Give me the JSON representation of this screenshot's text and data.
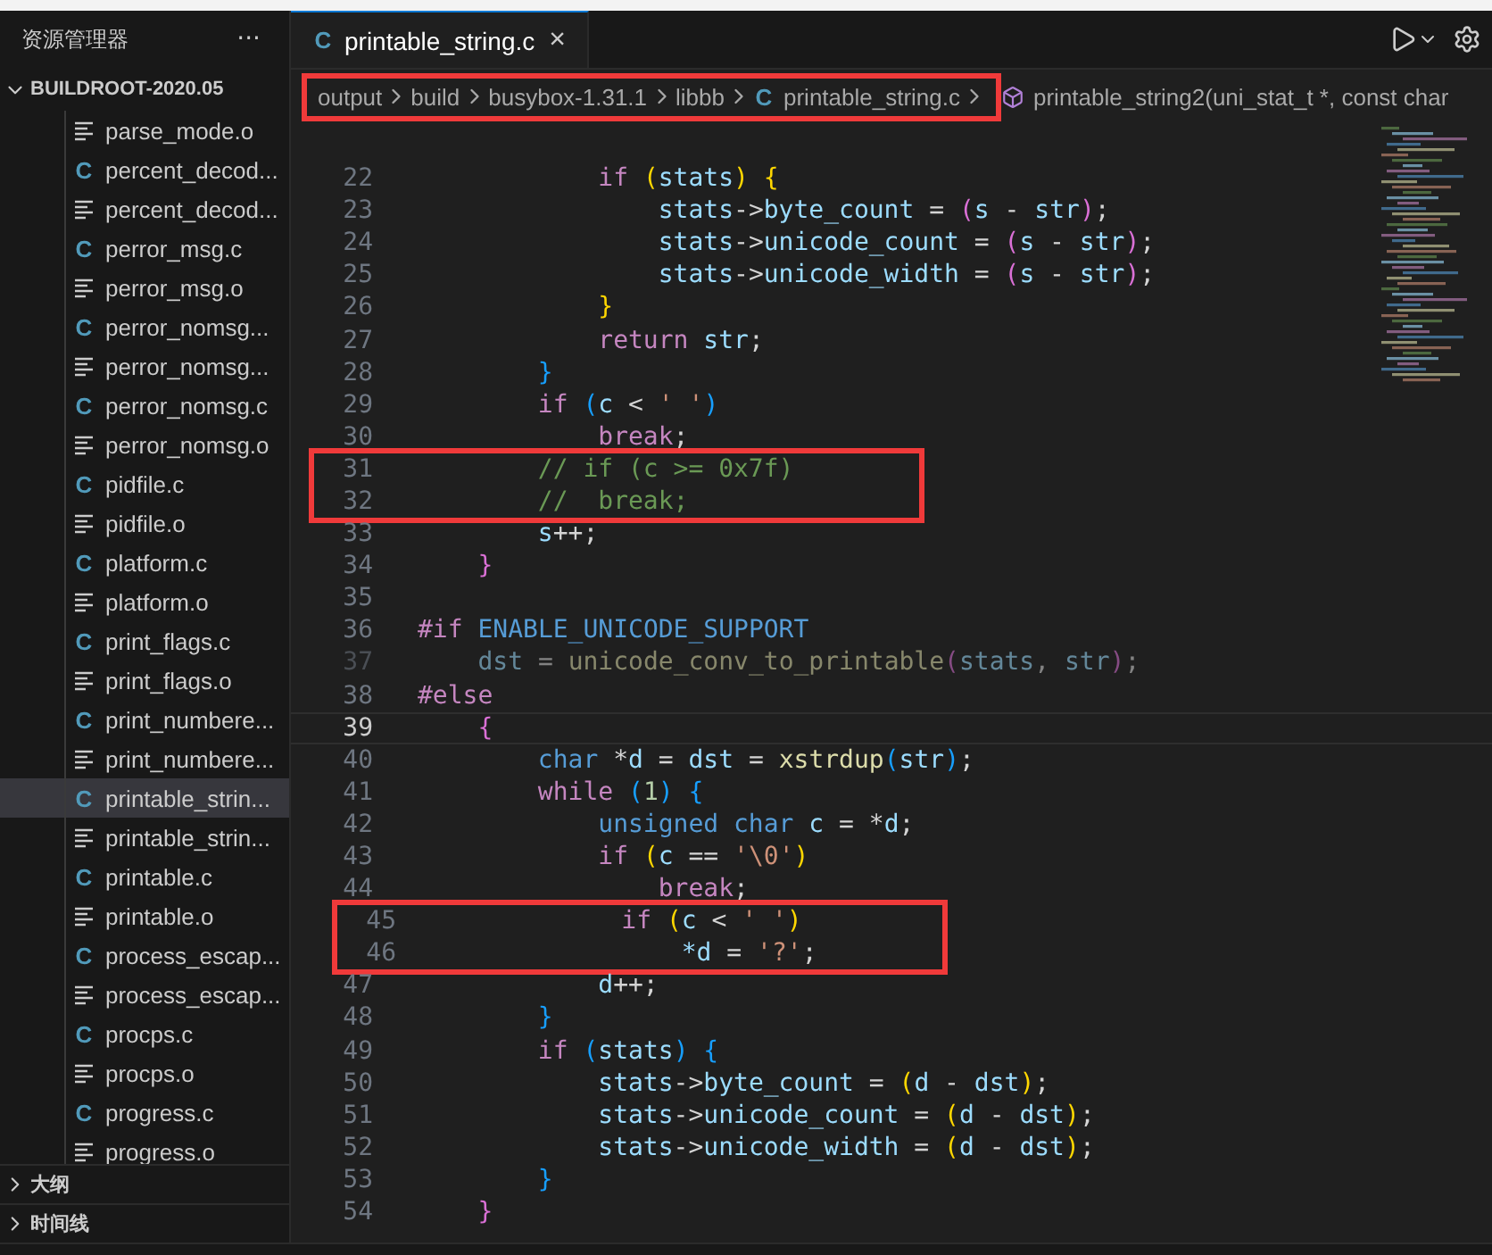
{
  "sidebar": {
    "title": "资源管理器",
    "more": "···",
    "root": {
      "label": "BUILDROOT-2020.05",
      "expanded": true
    },
    "files": [
      {
        "name": "parse_mode.o",
        "kind": "object",
        "selected": false
      },
      {
        "name": "percent_decod...",
        "kind": "source",
        "glyph": "C",
        "selected": false
      },
      {
        "name": "percent_decod...",
        "kind": "object",
        "selected": false
      },
      {
        "name": "perror_msg.c",
        "kind": "source",
        "glyph": "C",
        "selected": false
      },
      {
        "name": "perror_msg.o",
        "kind": "object",
        "selected": false
      },
      {
        "name": "perror_nomsg...",
        "kind": "source",
        "glyph": "C",
        "selected": false
      },
      {
        "name": "perror_nomsg...",
        "kind": "object",
        "selected": false
      },
      {
        "name": "perror_nomsg.c",
        "kind": "source",
        "glyph": "C",
        "selected": false
      },
      {
        "name": "perror_nomsg.o",
        "kind": "object",
        "selected": false
      },
      {
        "name": "pidfile.c",
        "kind": "source",
        "glyph": "C",
        "selected": false
      },
      {
        "name": "pidfile.o",
        "kind": "object",
        "selected": false
      },
      {
        "name": "platform.c",
        "kind": "source",
        "glyph": "C",
        "selected": false
      },
      {
        "name": "platform.o",
        "kind": "object",
        "selected": false
      },
      {
        "name": "print_flags.c",
        "kind": "source",
        "glyph": "C",
        "selected": false
      },
      {
        "name": "print_flags.o",
        "kind": "object",
        "selected": false
      },
      {
        "name": "print_numbere...",
        "kind": "source",
        "glyph": "C",
        "selected": false
      },
      {
        "name": "print_numbere...",
        "kind": "object",
        "selected": false
      },
      {
        "name": "printable_strin...",
        "kind": "source",
        "glyph": "C",
        "selected": true
      },
      {
        "name": "printable_strin...",
        "kind": "object",
        "selected": false
      },
      {
        "name": "printable.c",
        "kind": "source",
        "glyph": "C",
        "selected": false
      },
      {
        "name": "printable.o",
        "kind": "object",
        "selected": false
      },
      {
        "name": "process_escap...",
        "kind": "source",
        "glyph": "C",
        "selected": false
      },
      {
        "name": "process_escap...",
        "kind": "object",
        "selected": false
      },
      {
        "name": "procps.c",
        "kind": "source",
        "glyph": "C",
        "selected": false
      },
      {
        "name": "procps.o",
        "kind": "object",
        "selected": false
      },
      {
        "name": "progress.c",
        "kind": "source",
        "glyph": "C",
        "selected": false
      },
      {
        "name": "progress.o",
        "kind": "object",
        "selected": false
      }
    ],
    "sections": [
      {
        "label": "大纲",
        "expanded": false
      },
      {
        "label": "时间线",
        "expanded": false
      }
    ]
  },
  "tabs": [
    {
      "label": "printable_string.c",
      "glyph": "C",
      "selected": true,
      "close": "×"
    }
  ],
  "breadcrumb": [
    {
      "label": "output",
      "kind": "folder",
      "outlined": true
    },
    {
      "label": "build",
      "kind": "folder",
      "outlined": true
    },
    {
      "label": "busybox-1.31.1",
      "kind": "folder",
      "outlined": true
    },
    {
      "label": "libbb",
      "kind": "folder",
      "outlined": true
    },
    {
      "label": "printable_string.c",
      "kind": "file",
      "glyph": "C",
      "outlined": true
    },
    {
      "label": "printable_string2(uni_stat_t *, const char",
      "kind": "symbol",
      "outlined": false
    }
  ],
  "code": [
    {
      "number": "22",
      "boxed": false,
      "current": false,
      "inactive": false,
      "tokens": [
        {
          "kind": "kw",
          "text": "            if"
        },
        {
          "kind": "b1",
          "text": " ("
        },
        {
          "kind": "var",
          "text": "stats"
        },
        {
          "kind": "b1",
          "text": ")"
        },
        {
          "kind": "b1",
          "text": " {"
        }
      ]
    },
    {
      "number": "23",
      "boxed": false,
      "current": false,
      "inactive": false,
      "tokens": [
        {
          "kind": "var",
          "text": "                stats"
        },
        {
          "kind": "p",
          "text": "->"
        },
        {
          "kind": "var",
          "text": "byte_count"
        },
        {
          "kind": "p",
          "text": " = "
        },
        {
          "kind": "b2",
          "text": "("
        },
        {
          "kind": "var",
          "text": "s"
        },
        {
          "kind": "p",
          "text": " - "
        },
        {
          "kind": "var",
          "text": "str"
        },
        {
          "kind": "b2",
          "text": ")"
        },
        {
          "kind": "p",
          "text": ";"
        }
      ]
    },
    {
      "number": "24",
      "boxed": false,
      "current": false,
      "inactive": false,
      "tokens": [
        {
          "kind": "var",
          "text": "                stats"
        },
        {
          "kind": "p",
          "text": "->"
        },
        {
          "kind": "var",
          "text": "unicode_count"
        },
        {
          "kind": "p",
          "text": " = "
        },
        {
          "kind": "b2",
          "text": "("
        },
        {
          "kind": "var",
          "text": "s"
        },
        {
          "kind": "p",
          "text": " - "
        },
        {
          "kind": "var",
          "text": "str"
        },
        {
          "kind": "b2",
          "text": ")"
        },
        {
          "kind": "p",
          "text": ";"
        }
      ]
    },
    {
      "number": "25",
      "boxed": false,
      "current": false,
      "inactive": false,
      "tokens": [
        {
          "kind": "var",
          "text": "                stats"
        },
        {
          "kind": "p",
          "text": "->"
        },
        {
          "kind": "var",
          "text": "unicode_width"
        },
        {
          "kind": "p",
          "text": " = "
        },
        {
          "kind": "b2",
          "text": "("
        },
        {
          "kind": "var",
          "text": "s"
        },
        {
          "kind": "p",
          "text": " - "
        },
        {
          "kind": "var",
          "text": "str"
        },
        {
          "kind": "b2",
          "text": ")"
        },
        {
          "kind": "p",
          "text": ";"
        }
      ]
    },
    {
      "number": "26",
      "boxed": false,
      "current": false,
      "inactive": false,
      "tokens": [
        {
          "kind": "b1",
          "text": "            }"
        }
      ]
    },
    {
      "number": "27",
      "boxed": false,
      "current": false,
      "inactive": false,
      "tokens": [
        {
          "kind": "kw",
          "text": "            return"
        },
        {
          "kind": "var",
          "text": " str"
        },
        {
          "kind": "p",
          "text": ";"
        }
      ]
    },
    {
      "number": "28",
      "boxed": false,
      "current": false,
      "inactive": false,
      "tokens": [
        {
          "kind": "b3",
          "text": "        }"
        }
      ]
    },
    {
      "number": "29",
      "boxed": false,
      "current": false,
      "inactive": false,
      "tokens": [
        {
          "kind": "kw",
          "text": "        if"
        },
        {
          "kind": "b3",
          "text": " ("
        },
        {
          "kind": "var",
          "text": "c"
        },
        {
          "kind": "p",
          "text": " < "
        },
        {
          "kind": "str",
          "text": "' '"
        },
        {
          "kind": "b3",
          "text": ")"
        }
      ]
    },
    {
      "number": "30",
      "boxed": false,
      "current": false,
      "inactive": false,
      "tokens": [
        {
          "kind": "kw",
          "text": "            break"
        },
        {
          "kind": "p",
          "text": ";"
        }
      ]
    },
    {
      "number": "31",
      "boxed": true,
      "current": false,
      "inactive": false,
      "tokens": [
        {
          "kind": "com",
          "text": "        // if (c >= 0x7f)"
        }
      ]
    },
    {
      "number": "32",
      "boxed": true,
      "current": false,
      "inactive": false,
      "tokens": [
        {
          "kind": "com",
          "text": "        //  break;"
        }
      ]
    },
    {
      "number": "33",
      "boxed": false,
      "current": false,
      "inactive": false,
      "tokens": [
        {
          "kind": "var",
          "text": "        s"
        },
        {
          "kind": "p",
          "text": "++;"
        }
      ]
    },
    {
      "number": "34",
      "boxed": false,
      "current": false,
      "inactive": false,
      "tokens": [
        {
          "kind": "b2",
          "text": "    }"
        }
      ]
    },
    {
      "number": "35",
      "boxed": false,
      "current": false,
      "inactive": false
    },
    {
      "number": "36",
      "boxed": false,
      "current": false,
      "inactive": false,
      "tokens": [
        {
          "kind": "pre",
          "text": "#if"
        },
        {
          "kind": "macro",
          "text": " ENABLE_UNICODE_SUPPORT"
        }
      ]
    },
    {
      "number": "37",
      "boxed": false,
      "current": false,
      "inactive": true,
      "tokens": [
        {
          "kind": "var",
          "text": "    dst"
        },
        {
          "kind": "p",
          "text": " = "
        },
        {
          "kind": "fn",
          "text": "unicode_conv_to_printable"
        },
        {
          "kind": "b2",
          "text": "("
        },
        {
          "kind": "var",
          "text": "stats"
        },
        {
          "kind": "p",
          "text": ", "
        },
        {
          "kind": "var",
          "text": "str"
        },
        {
          "kind": "b2",
          "text": ")"
        },
        {
          "kind": "p",
          "text": ";"
        }
      ]
    },
    {
      "number": "38",
      "boxed": false,
      "current": false,
      "inactive": false,
      "tokens": [
        {
          "kind": "pre",
          "text": "#else"
        }
      ]
    },
    {
      "number": "39",
      "boxed": false,
      "current": true,
      "inactive": false,
      "tokens": [
        {
          "kind": "b2",
          "text": "    {"
        }
      ]
    },
    {
      "number": "40",
      "boxed": false,
      "current": false,
      "inactive": false,
      "tokens": [
        {
          "kind": "type",
          "text": "        char"
        },
        {
          "kind": "p",
          "text": " *"
        },
        {
          "kind": "var",
          "text": "d"
        },
        {
          "kind": "p",
          "text": " = "
        },
        {
          "kind": "var",
          "text": "dst"
        },
        {
          "kind": "p",
          "text": " = "
        },
        {
          "kind": "fn",
          "text": "xstrdup"
        },
        {
          "kind": "b3",
          "text": "("
        },
        {
          "kind": "var",
          "text": "str"
        },
        {
          "kind": "b3",
          "text": ")"
        },
        {
          "kind": "p",
          "text": ";"
        }
      ]
    },
    {
      "number": "41",
      "boxed": false,
      "current": false,
      "inactive": false,
      "tokens": [
        {
          "kind": "kw",
          "text": "        while"
        },
        {
          "kind": "b3",
          "text": " ("
        },
        {
          "kind": "num",
          "text": "1"
        },
        {
          "kind": "b3",
          "text": ")"
        },
        {
          "kind": "b3",
          "text": " {"
        }
      ]
    },
    {
      "number": "42",
      "boxed": false,
      "current": false,
      "inactive": false,
      "tokens": [
        {
          "kind": "type",
          "text": "            unsigned"
        },
        {
          "kind": "type",
          "text": " char"
        },
        {
          "kind": "var",
          "text": " c"
        },
        {
          "kind": "p",
          "text": " = *"
        },
        {
          "kind": "var",
          "text": "d"
        },
        {
          "kind": "p",
          "text": ";"
        }
      ]
    },
    {
      "number": "43",
      "boxed": false,
      "current": false,
      "inactive": false,
      "tokens": [
        {
          "kind": "kw",
          "text": "            if"
        },
        {
          "kind": "b1",
          "text": " ("
        },
        {
          "kind": "var",
          "text": "c"
        },
        {
          "kind": "p",
          "text": " == "
        },
        {
          "kind": "str",
          "text": "'\\0'"
        },
        {
          "kind": "b1",
          "text": ")"
        }
      ]
    },
    {
      "number": "44",
      "boxed": false,
      "current": false,
      "inactive": false,
      "tokens": [
        {
          "kind": "kw",
          "text": "                break"
        },
        {
          "kind": "p",
          "text": ";"
        }
      ]
    },
    {
      "number": "45",
      "boxed": true,
      "current": false,
      "inactive": false,
      "tokens": [
        {
          "kind": "kw",
          "text": "            if"
        },
        {
          "kind": "b1",
          "text": " ("
        },
        {
          "kind": "var",
          "text": "c"
        },
        {
          "kind": "p",
          "text": " < "
        },
        {
          "kind": "str",
          "text": "' '"
        },
        {
          "kind": "b1",
          "text": ")"
        }
      ]
    },
    {
      "number": "46",
      "boxed": true,
      "current": false,
      "inactive": false,
      "tokens": [
        {
          "kind": "var",
          "text": "                *d"
        },
        {
          "kind": "p",
          "text": " = "
        },
        {
          "kind": "str",
          "text": "'?'"
        },
        {
          "kind": "p",
          "text": ";"
        }
      ]
    },
    {
      "number": "47",
      "boxed": false,
      "current": false,
      "inactive": false,
      "tokens": [
        {
          "kind": "var",
          "text": "            d"
        },
        {
          "kind": "p",
          "text": "++;"
        }
      ]
    },
    {
      "number": "48",
      "boxed": false,
      "current": false,
      "inactive": false,
      "tokens": [
        {
          "kind": "b3",
          "text": "        }"
        }
      ]
    },
    {
      "number": "49",
      "boxed": false,
      "current": false,
      "inactive": false,
      "tokens": [
        {
          "kind": "kw",
          "text": "        if"
        },
        {
          "kind": "b3",
          "text": " ("
        },
        {
          "kind": "var",
          "text": "stats"
        },
        {
          "kind": "b3",
          "text": ")"
        },
        {
          "kind": "b3",
          "text": " {"
        }
      ]
    },
    {
      "number": "50",
      "boxed": false,
      "current": false,
      "inactive": false,
      "tokens": [
        {
          "kind": "var",
          "text": "            stats"
        },
        {
          "kind": "p",
          "text": "->"
        },
        {
          "kind": "var",
          "text": "byte_count"
        },
        {
          "kind": "p",
          "text": " = "
        },
        {
          "kind": "b1",
          "text": "("
        },
        {
          "kind": "var",
          "text": "d"
        },
        {
          "kind": "p",
          "text": " - "
        },
        {
          "kind": "var",
          "text": "dst"
        },
        {
          "kind": "b1",
          "text": ")"
        },
        {
          "kind": "p",
          "text": ";"
        }
      ]
    },
    {
      "number": "51",
      "boxed": false,
      "current": false,
      "inactive": false,
      "tokens": [
        {
          "kind": "var",
          "text": "            stats"
        },
        {
          "kind": "p",
          "text": "->"
        },
        {
          "kind": "var",
          "text": "unicode_count"
        },
        {
          "kind": "p",
          "text": " = "
        },
        {
          "kind": "b1",
          "text": "("
        },
        {
          "kind": "var",
          "text": "d"
        },
        {
          "kind": "p",
          "text": " - "
        },
        {
          "kind": "var",
          "text": "dst"
        },
        {
          "kind": "b1",
          "text": ")"
        },
        {
          "kind": "p",
          "text": ";"
        }
      ]
    },
    {
      "number": "52",
      "boxed": false,
      "current": false,
      "inactive": false,
      "tokens": [
        {
          "kind": "var",
          "text": "            stats"
        },
        {
          "kind": "p",
          "text": "->"
        },
        {
          "kind": "var",
          "text": "unicode_width"
        },
        {
          "kind": "p",
          "text": " = "
        },
        {
          "kind": "b1",
          "text": "("
        },
        {
          "kind": "var",
          "text": "d"
        },
        {
          "kind": "p",
          "text": " - "
        },
        {
          "kind": "var",
          "text": "dst"
        },
        {
          "kind": "b1",
          "text": ")"
        },
        {
          "kind": "p",
          "text": ";"
        }
      ]
    },
    {
      "number": "53",
      "boxed": false,
      "current": false,
      "inactive": false,
      "tokens": [
        {
          "kind": "b3",
          "text": "        }"
        }
      ]
    },
    {
      "number": "54",
      "boxed": false,
      "current": false,
      "inactive": false,
      "tokens": [
        {
          "kind": "b2",
          "text": "    }"
        }
      ]
    }
  ]
}
